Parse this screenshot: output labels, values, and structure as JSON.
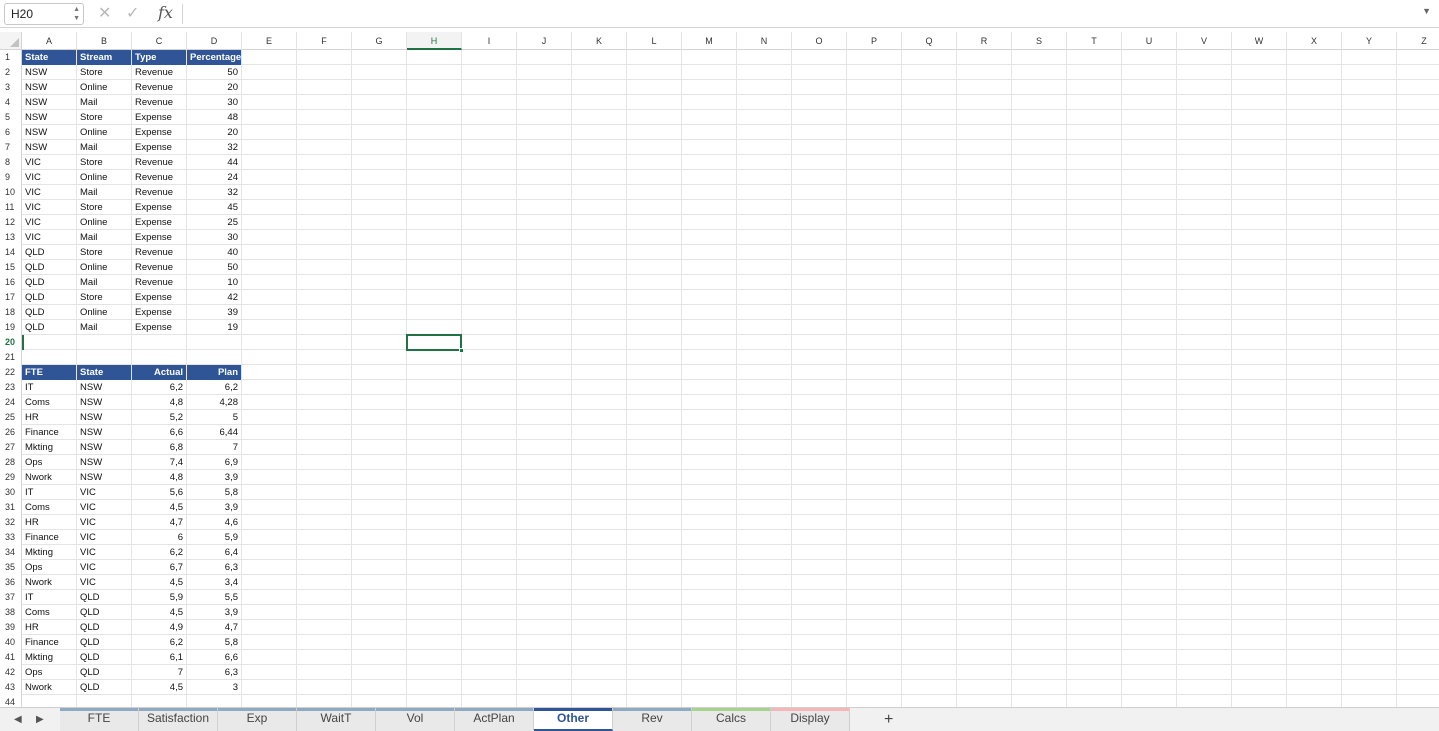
{
  "formula_bar": {
    "name_box": "H20",
    "cancel_glyph": "✕",
    "confirm_glyph": "✓",
    "fx_label": "fx",
    "formula": ""
  },
  "grid": {
    "columns": [
      "A",
      "B",
      "C",
      "D",
      "E",
      "F",
      "G",
      "H",
      "I",
      "J",
      "K",
      "L",
      "M",
      "N",
      "O",
      "P",
      "Q",
      "R",
      "S",
      "T",
      "U",
      "V",
      "W",
      "X",
      "Y",
      "Z"
    ],
    "active_column": "H",
    "active_row": 20,
    "selected_cell": "H20",
    "row_count": 44,
    "header_fill_color": "#2f5597",
    "cells": {
      "A1": "State",
      "B1": "Stream",
      "C1": "Type",
      "D1": "Percentage",
      "A2": "NSW",
      "B2": "Store",
      "C2": "Revenue",
      "D2": "50",
      "A3": "NSW",
      "B3": "Online",
      "C3": "Revenue",
      "D3": "20",
      "A4": "NSW",
      "B4": "Mail",
      "C4": "Revenue",
      "D4": "30",
      "A5": "NSW",
      "B5": "Store",
      "C5": "Expense",
      "D5": "48",
      "A6": "NSW",
      "B6": "Online",
      "C6": "Expense",
      "D6": "20",
      "A7": "NSW",
      "B7": "Mail",
      "C7": "Expense",
      "D7": "32",
      "A8": "VIC",
      "B8": "Store",
      "C8": "Revenue",
      "D8": "44",
      "A9": "VIC",
      "B9": "Online",
      "C9": "Revenue",
      "D9": "24",
      "A10": "VIC",
      "B10": "Mail",
      "C10": "Revenue",
      "D10": "32",
      "A11": "VIC",
      "B11": "Store",
      "C11": "Expense",
      "D11": "45",
      "A12": "VIC",
      "B12": "Online",
      "C12": "Expense",
      "D12": "25",
      "A13": "VIC",
      "B13": "Mail",
      "C13": "Expense",
      "D13": "30",
      "A14": "QLD",
      "B14": "Store",
      "C14": "Revenue",
      "D14": "40",
      "A15": "QLD",
      "B15": "Online",
      "C15": "Revenue",
      "D15": "50",
      "A16": "QLD",
      "B16": "Mail",
      "C16": "Revenue",
      "D16": "10",
      "A17": "QLD",
      "B17": "Store",
      "C17": "Expense",
      "D17": "42",
      "A18": "QLD",
      "B18": "Online",
      "C18": "Expense",
      "D18": "39",
      "A19": "QLD",
      "B19": "Mail",
      "C19": "Expense",
      "D19": "19",
      "A22": "FTE",
      "B22": "State",
      "C22": "Actual",
      "D22": "Plan",
      "A23": "IT",
      "B23": "NSW",
      "C23": "6,2",
      "D23": "6,2",
      "A24": "Coms",
      "B24": "NSW",
      "C24": "4,8",
      "D24": "4,28",
      "A25": "HR",
      "B25": "NSW",
      "C25": "5,2",
      "D25": "5",
      "A26": "Finance",
      "B26": "NSW",
      "C26": "6,6",
      "D26": "6,44",
      "A27": "Mkting",
      "B27": "NSW",
      "C27": "6,8",
      "D27": "7",
      "A28": "Ops",
      "B28": "NSW",
      "C28": "7,4",
      "D28": "6,9",
      "A29": "Nwork",
      "B29": "NSW",
      "C29": "4,8",
      "D29": "3,9",
      "A30": "IT",
      "B30": "VIC",
      "C30": "5,6",
      "D30": "5,8",
      "A31": "Coms",
      "B31": "VIC",
      "C31": "4,5",
      "D31": "3,9",
      "A32": "HR",
      "B32": "VIC",
      "C32": "4,7",
      "D32": "4,6",
      "A33": "Finance",
      "B33": "VIC",
      "C33": "6",
      "D33": "5,9",
      "A34": "Mkting",
      "B34": "VIC",
      "C34": "6,2",
      "D34": "6,4",
      "A35": "Ops",
      "B35": "VIC",
      "C35": "6,7",
      "D35": "6,3",
      "A36": "Nwork",
      "B36": "VIC",
      "C36": "4,5",
      "D36": "3,4",
      "A37": "IT",
      "B37": "QLD",
      "C37": "5,9",
      "D37": "5,5",
      "A38": "Coms",
      "B38": "QLD",
      "C38": "4,5",
      "D38": "3,9",
      "A39": "HR",
      "B39": "QLD",
      "C39": "4,9",
      "D39": "4,7",
      "A40": "Finance",
      "B40": "QLD",
      "C40": "6,2",
      "D40": "5,8",
      "A41": "Mkting",
      "B41": "QLD",
      "C41": "6,1",
      "D41": "6,6",
      "A42": "Ops",
      "B42": "QLD",
      "C42": "7",
      "D42": "6,3",
      "A43": "Nwork",
      "B43": "QLD",
      "C43": "4,5",
      "D43": "3"
    }
  },
  "sheet_tabs": {
    "nav_prev": "◀",
    "nav_next": "▶",
    "add_label": "+",
    "active": "Other",
    "tabs": [
      {
        "label": "FTE",
        "color": "#8ea9c1"
      },
      {
        "label": "Satisfaction",
        "color": "#8ea9c1"
      },
      {
        "label": "Exp",
        "color": "#8ea9c1"
      },
      {
        "label": "WaitT",
        "color": "#8ea9c1"
      },
      {
        "label": "Vol",
        "color": "#8ea9c1"
      },
      {
        "label": "ActPlan",
        "color": "#8ea9c1"
      },
      {
        "label": "Other",
        "color": "#2f5597"
      },
      {
        "label": "Rev",
        "color": "#8ea9c1"
      },
      {
        "label": "Calcs",
        "color": "#a9d18e"
      },
      {
        "label": "Display",
        "color": "#f4b6b6"
      }
    ]
  }
}
